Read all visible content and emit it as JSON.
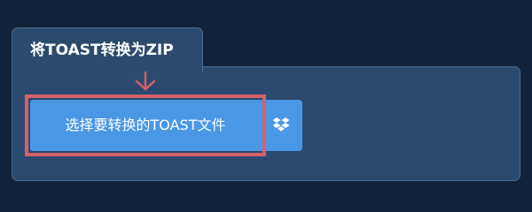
{
  "converter": {
    "tab_title": "将TOAST转换为ZIP",
    "upload_button_label": "选择要转换的TOAST文件"
  },
  "icons": {
    "arrow": "arrow-down-icon",
    "dropbox": "dropbox-icon"
  },
  "colors": {
    "page_background": "#11223a",
    "panel_background": "#2c4a6e",
    "button_blue": "#4a97e6",
    "highlight_red": "#d5606a"
  }
}
